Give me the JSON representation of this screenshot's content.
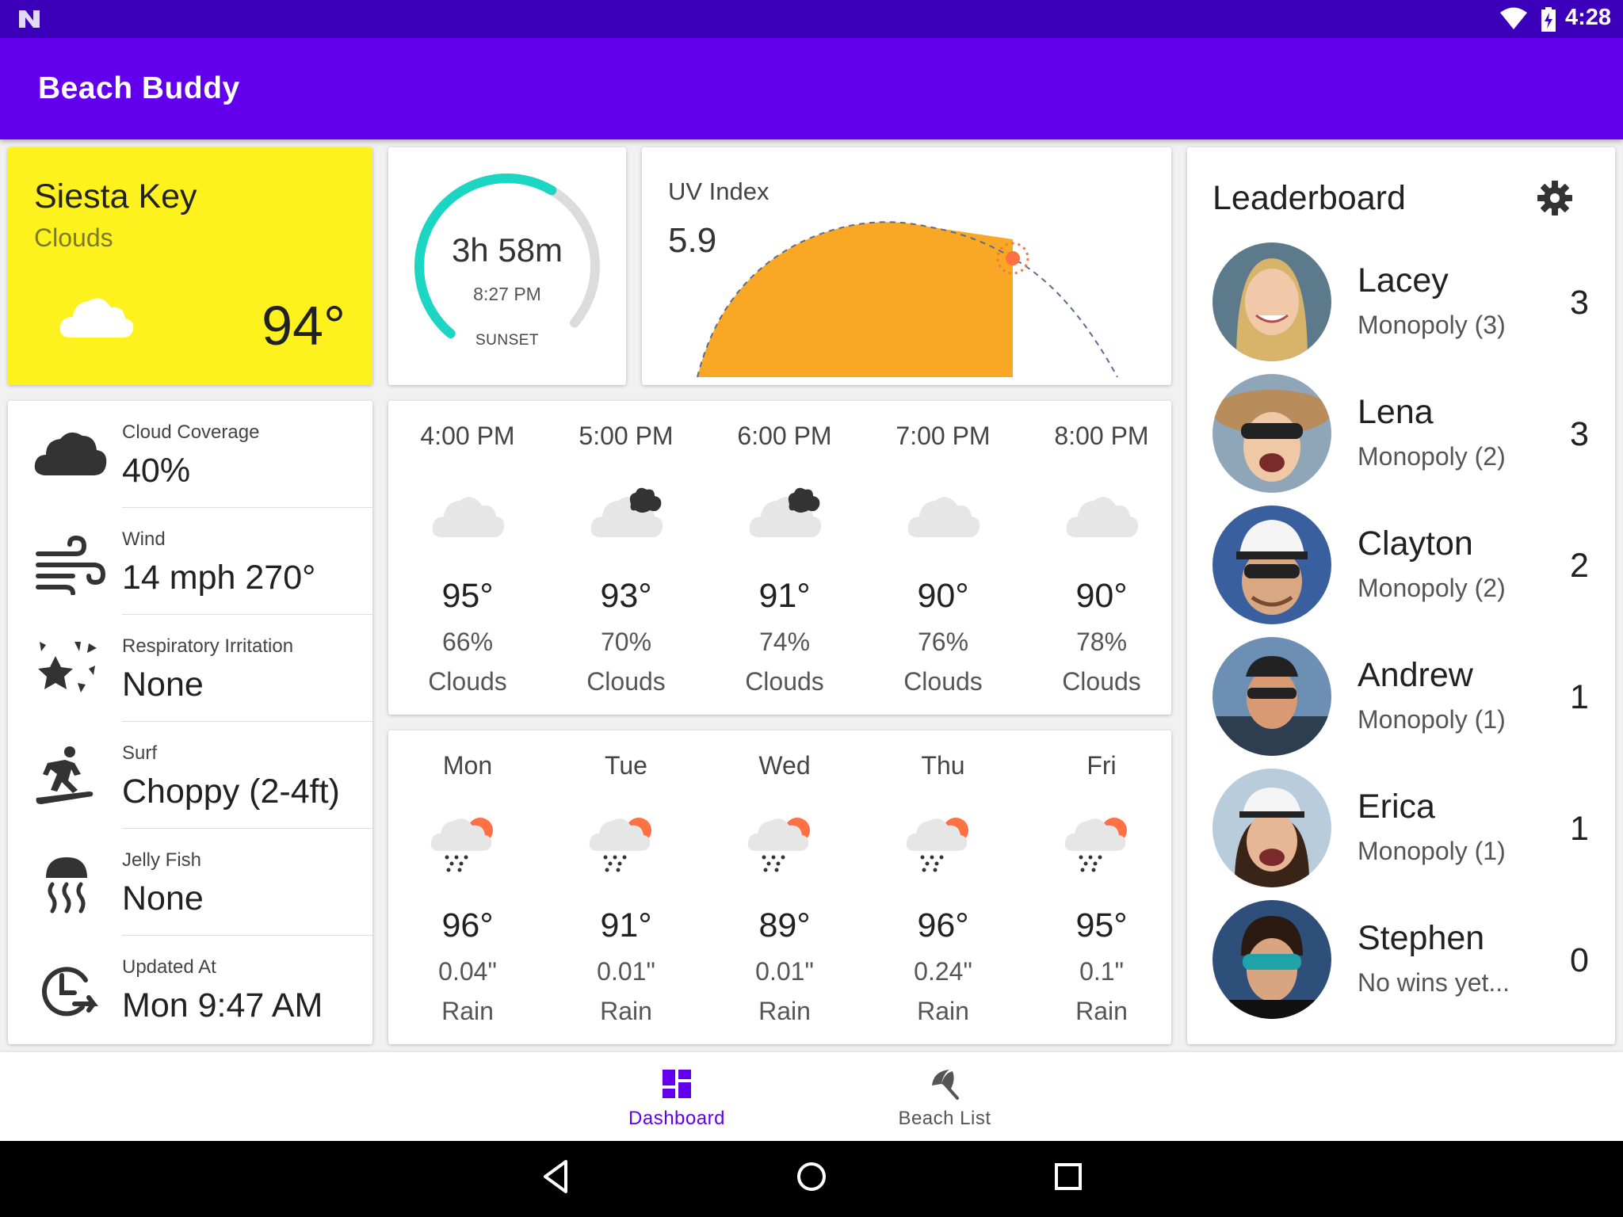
{
  "status_bar": {
    "time": "4:28"
  },
  "app_bar": {
    "title": "Beach Buddy"
  },
  "beach": {
    "name": "Siesta Key",
    "condition": "Clouds",
    "temperature": "94°",
    "icon": "cloud-icon",
    "card_color": "#fdf21e"
  },
  "sunset": {
    "remaining": "3h 58m",
    "time": "8:27 PM",
    "label": "SUNSET",
    "progress_fraction": 0.6,
    "accent_color": "#1dd5c3"
  },
  "uv": {
    "label": "UV Index",
    "value": "5.9",
    "fill_color": "#f9a825",
    "sun_color": "#ff7043"
  },
  "conditions": [
    {
      "icon": "cloud-icon",
      "label": "Cloud Coverage",
      "value": "40%"
    },
    {
      "icon": "wind-icon",
      "label": "Wind",
      "value": "14 mph 270°"
    },
    {
      "icon": "allergy-icon",
      "label": "Respiratory Irritation",
      "value": "None"
    },
    {
      "icon": "surf-icon",
      "label": "Surf",
      "value": "Choppy (2-4ft)"
    },
    {
      "icon": "jellyfish-icon",
      "label": "Jelly Fish",
      "value": "None"
    },
    {
      "icon": "clock-icon",
      "label": "Updated At",
      "value": "Mon 9:47 AM"
    }
  ],
  "hourly": [
    {
      "time": "4:00 PM",
      "icon": "cloud-icon",
      "temp": "95°",
      "humidity": "66%",
      "desc": "Clouds"
    },
    {
      "time": "5:00 PM",
      "icon": "cloudy-dark-icon",
      "temp": "93°",
      "humidity": "70%",
      "desc": "Clouds"
    },
    {
      "time": "6:00 PM",
      "icon": "cloudy-dark-icon",
      "temp": "91°",
      "humidity": "74%",
      "desc": "Clouds"
    },
    {
      "time": "7:00 PM",
      "icon": "cloud-icon",
      "temp": "90°",
      "humidity": "76%",
      "desc": "Clouds"
    },
    {
      "time": "8:00 PM",
      "icon": "cloud-icon",
      "temp": "90°",
      "humidity": "78%",
      "desc": "Clouds"
    }
  ],
  "daily": [
    {
      "day": "Mon",
      "icon": "rain-sun-icon",
      "temp": "96°",
      "precip": "0.04\"",
      "desc": "Rain"
    },
    {
      "day": "Tue",
      "icon": "rain-sun-icon",
      "temp": "91°",
      "precip": "0.01\"",
      "desc": "Rain"
    },
    {
      "day": "Wed",
      "icon": "rain-sun-icon",
      "temp": "89°",
      "precip": "0.01\"",
      "desc": "Rain"
    },
    {
      "day": "Thu",
      "icon": "rain-sun-icon",
      "temp": "96°",
      "precip": "0.24\"",
      "desc": "Rain"
    },
    {
      "day": "Fri",
      "icon": "rain-sun-icon",
      "temp": "95°",
      "precip": "0.1\"",
      "desc": "Rain"
    }
  ],
  "leaderboard": {
    "title": "Leaderboard",
    "settings_icon": "gear-icon",
    "players": [
      {
        "name": "Lacey",
        "game": "Monopoly (3)",
        "score": "3",
        "avatar_color": "#c9a66b"
      },
      {
        "name": "Lena",
        "game": "Monopoly (2)",
        "score": "3",
        "avatar_color": "#b98c5c"
      },
      {
        "name": "Clayton",
        "game": "Monopoly (2)",
        "score": "2",
        "avatar_color": "#3a5f9e"
      },
      {
        "name": "Andrew",
        "game": "Monopoly (1)",
        "score": "1",
        "avatar_color": "#6c8fb3"
      },
      {
        "name": "Erica",
        "game": "Monopoly (1)",
        "score": "1",
        "avatar_color": "#8aa7c4"
      },
      {
        "name": "Stephen",
        "game": "No wins yet...",
        "score": "0",
        "avatar_color": "#2d4f7a"
      }
    ]
  },
  "bottom_nav": [
    {
      "label": "Dashboard",
      "icon": "dashboard-icon",
      "active": true
    },
    {
      "label": "Beach List",
      "icon": "beach-umbrella-icon",
      "active": false
    }
  ],
  "accent_color": "#6200ee"
}
